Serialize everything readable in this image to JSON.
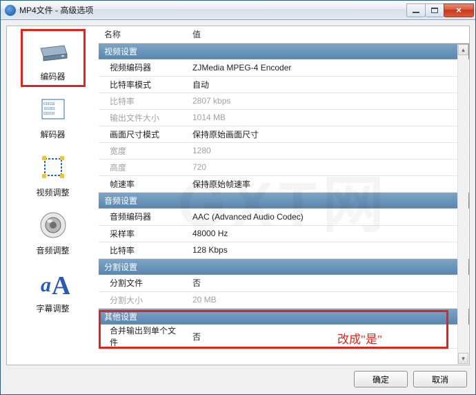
{
  "window": {
    "title": "MP4文件 - 高级选项"
  },
  "sidebar": {
    "items": [
      {
        "label": "编码器"
      },
      {
        "label": "解码器"
      },
      {
        "label": "视频调整"
      },
      {
        "label": "音频调整"
      },
      {
        "label": "字幕调整"
      }
    ]
  },
  "table": {
    "col_name": "名称",
    "col_value": "值",
    "sections": [
      {
        "title": "视频设置",
        "rows": [
          {
            "name": "视频编码器",
            "value": "ZJMedia MPEG-4 Encoder",
            "disabled": false
          },
          {
            "name": "比特率模式",
            "value": "自动",
            "disabled": false
          },
          {
            "name": "比特率",
            "value": "2807 kbps",
            "disabled": true
          },
          {
            "name": "输出文件大小",
            "value": "1014 MB",
            "disabled": true
          },
          {
            "name": "画面尺寸模式",
            "value": "保持原始画面尺寸",
            "disabled": false
          },
          {
            "name": "宽度",
            "value": "1280",
            "disabled": true
          },
          {
            "name": "高度",
            "value": "720",
            "disabled": true
          },
          {
            "name": "帧速率",
            "value": "保持原始帧速率",
            "disabled": false
          }
        ]
      },
      {
        "title": "音频设置",
        "rows": [
          {
            "name": "音频编码器",
            "value": "AAC (Advanced Audio Codec)",
            "disabled": false
          },
          {
            "name": "采样率",
            "value": "48000 Hz",
            "disabled": false
          },
          {
            "name": "比特率",
            "value": "128 Kbps",
            "disabled": false
          }
        ]
      },
      {
        "title": "分割设置",
        "rows": [
          {
            "name": "分割文件",
            "value": "否",
            "disabled": false
          },
          {
            "name": "分割大小",
            "value": "20 MB",
            "disabled": true
          }
        ]
      },
      {
        "title": "其他设置",
        "rows": [
          {
            "name": "合并输出到单个文件",
            "value": "否",
            "disabled": false
          }
        ]
      }
    ]
  },
  "annotation": {
    "text": "改成\"是\""
  },
  "buttons": {
    "ok": "确定",
    "cancel": "取消"
  }
}
